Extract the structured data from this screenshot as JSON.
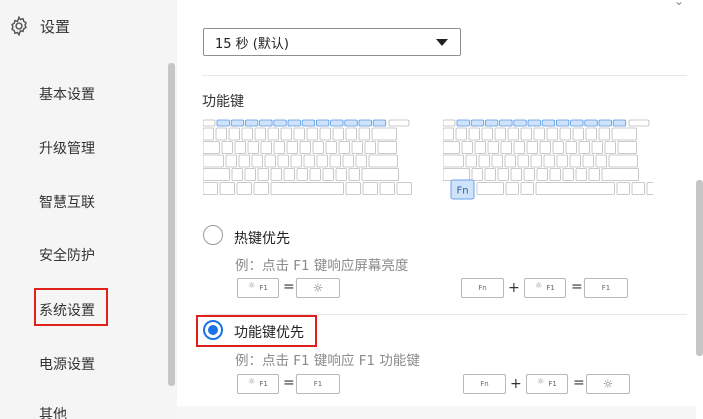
{
  "sidebar": {
    "title": "设置",
    "items": [
      {
        "label": "基本设置"
      },
      {
        "label": "升级管理"
      },
      {
        "label": "智慧互联"
      },
      {
        "label": "安全防护"
      },
      {
        "label": "系统设置"
      },
      {
        "label": "电源设置"
      },
      {
        "label": "其他"
      }
    ],
    "selected": "系统设置"
  },
  "main": {
    "timeout_select": {
      "value": "15 秒 (默认)"
    },
    "function_key": {
      "title": "功能键",
      "fn_label": "Fn",
      "options": [
        {
          "label": "热键优先",
          "selected": false,
          "example": "例：点击 F1 键响应屏幕亮度",
          "eq_left": {
            "key": "F1",
            "result_key": "brightness-icon"
          },
          "eq_right": {
            "mod": "Fn",
            "key": "F1",
            "result_key": "F1"
          }
        },
        {
          "label": "功能键优先",
          "selected": true,
          "example": "例：点击 F1 键响应 F1 功能键",
          "eq_left": {
            "key": "F1",
            "result_key": "F1"
          },
          "eq_right": {
            "mod": "Fn",
            "key": "F1",
            "result_key": "brightness-icon"
          }
        }
      ]
    }
  },
  "symbols": {
    "plus": "+",
    "equals": "="
  },
  "colors": {
    "accent": "#1a73e8",
    "highlight": "#e0201b",
    "fkey_fill": "#cfe3fb"
  }
}
